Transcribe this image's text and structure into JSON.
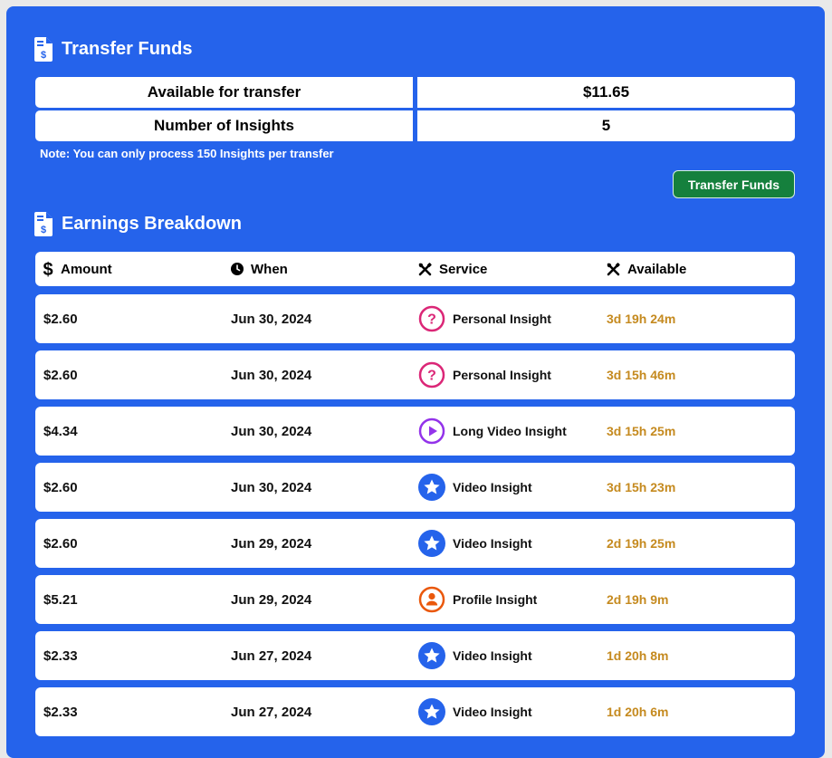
{
  "transfer": {
    "title": "Transfer Funds",
    "available_label": "Available for transfer",
    "available_value": "$11.65",
    "insights_label": "Number of Insights",
    "insights_value": "5",
    "note": "Note: You can only process 150 Insights per transfer",
    "button_label": "Transfer Funds"
  },
  "earnings": {
    "title": "Earnings Breakdown",
    "headers": {
      "amount": "Amount",
      "when": "When",
      "service": "Service",
      "available": "Available"
    },
    "rows": [
      {
        "amount": "$2.60",
        "when": "Jun 30, 2024",
        "service": "Personal Insight",
        "icon": "question-icon",
        "available": "3d 19h 24m"
      },
      {
        "amount": "$2.60",
        "when": "Jun 30, 2024",
        "service": "Personal Insight",
        "icon": "question-icon",
        "available": "3d 15h 46m"
      },
      {
        "amount": "$4.34",
        "when": "Jun 30, 2024",
        "service": "Long Video Insight",
        "icon": "play-icon",
        "available": "3d 15h 25m"
      },
      {
        "amount": "$2.60",
        "when": "Jun 30, 2024",
        "service": "Video Insight",
        "icon": "star-icon",
        "available": "3d 15h 23m"
      },
      {
        "amount": "$2.60",
        "when": "Jun 29, 2024",
        "service": "Video Insight",
        "icon": "star-icon",
        "available": "2d 19h 25m"
      },
      {
        "amount": "$5.21",
        "when": "Jun 29, 2024",
        "service": "Profile Insight",
        "icon": "user-icon",
        "available": "2d 19h 9m"
      },
      {
        "amount": "$2.33",
        "when": "Jun 27, 2024",
        "service": "Video Insight",
        "icon": "star-icon",
        "available": "1d 20h 8m"
      },
      {
        "amount": "$2.33",
        "when": "Jun 27, 2024",
        "service": "Video Insight",
        "icon": "star-icon",
        "available": "1d 20h 6m"
      }
    ]
  },
  "colors": {
    "panel": "#2563eb",
    "button": "#15803d",
    "available_text": "#c58a1f",
    "personal_icon": "#db2777",
    "long_video_icon": "#9333ea",
    "video_icon": "#2563eb",
    "profile_icon": "#ea580c"
  }
}
